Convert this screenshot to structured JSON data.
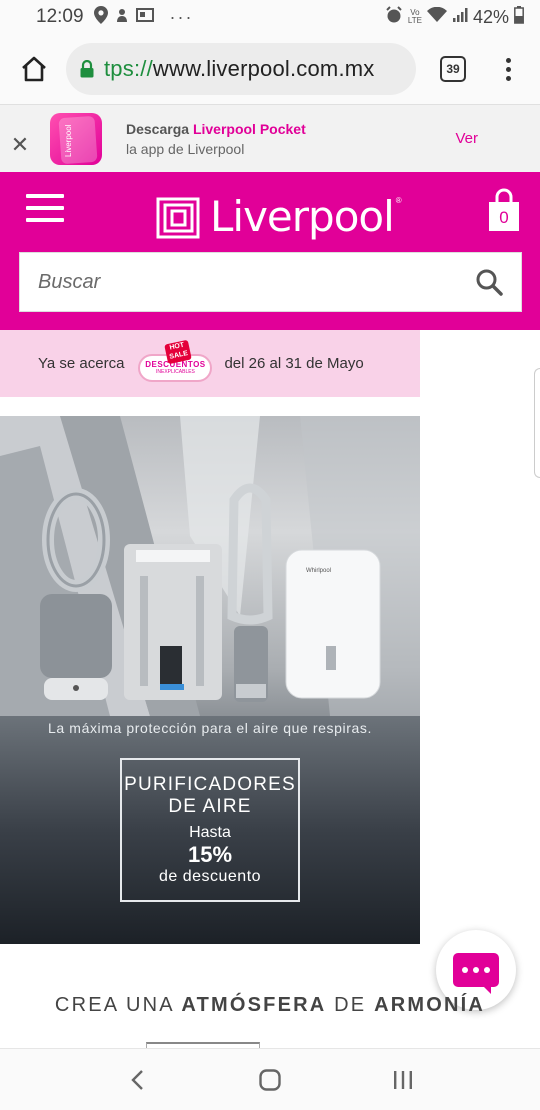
{
  "status_bar": {
    "time": "12:09",
    "battery": "42%"
  },
  "browser": {
    "url_scheme": "tps://",
    "url_host": "www.liverpool.com.mx",
    "tab_count": "39"
  },
  "app_banner": {
    "line1_prefix": "Descarga ",
    "line1_brand": "Liverpool Pocket",
    "line2": "la app de Liverpool",
    "action": "Ver",
    "icon_text": "Liverpool"
  },
  "header": {
    "logo_text": "Liverpool",
    "logo_reg": "®",
    "cart_count": "0",
    "search_placeholder": "Buscar"
  },
  "promo_strip": {
    "text_left": "Ya se acerca",
    "badge_hot": "HOT",
    "badge_sale": "SALE",
    "badge_title": "DESCUENTOS",
    "badge_subtitle": "INEXPLICABLES",
    "text_right": "del 26 al 31 de Mayo"
  },
  "hero": {
    "tagline": "La máxima protección para el aire que respiras.",
    "offer_line1": "PURIFICADORES",
    "offer_line2": "DE AIRE",
    "offer_line3": "Hasta",
    "offer_value": "15%",
    "offer_line5": "de descuento",
    "dehumidifier_brand": "Whirlpool"
  },
  "section": {
    "t1": "CREA UNA ",
    "t2": "ATMÓSFERA",
    "t3": " DE ",
    "t4": "ARMONÍA"
  },
  "colors": {
    "brand_pink": "#e10098",
    "promo_pink": "#f9d2e8",
    "secure_green": "#1e8e3e"
  },
  "icons": [
    "location-icon",
    "notification-icon",
    "gallery-icon",
    "alarm-icon",
    "volte-icon",
    "wifi-icon",
    "signal-icon",
    "battery-icon",
    "home-icon",
    "lock-icon",
    "tabs-icon",
    "overflow-menu-icon",
    "close-icon",
    "hamburger-icon",
    "cart-icon",
    "search-icon",
    "chat-icon",
    "back-icon",
    "home-nav-icon",
    "recents-icon"
  ]
}
